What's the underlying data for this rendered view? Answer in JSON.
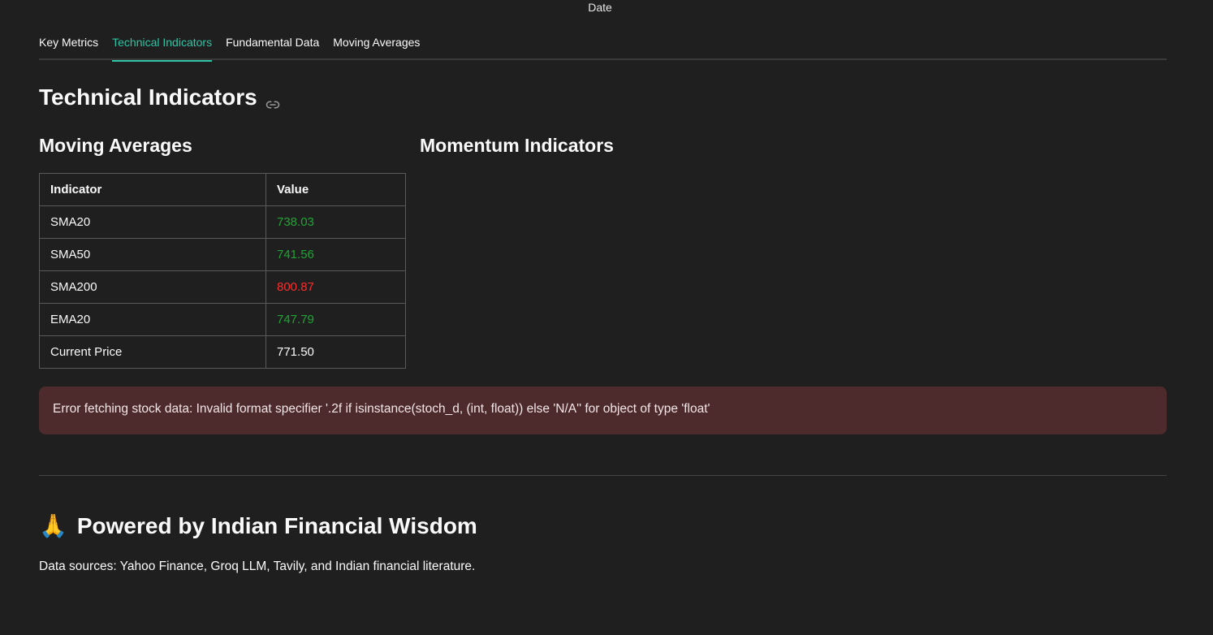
{
  "chart_axis": {
    "xlabel": "Date"
  },
  "tabs": [
    {
      "label": "Key Metrics",
      "active": false
    },
    {
      "label": "Technical Indicators",
      "active": true
    },
    {
      "label": "Fundamental Data",
      "active": false
    },
    {
      "label": "Moving Averages",
      "active": false
    }
  ],
  "main": {
    "title": "Technical Indicators",
    "title_icon": "link-icon",
    "moving_averages": {
      "title": "Moving Averages",
      "headers": [
        "Indicator",
        "Value"
      ],
      "rows": [
        {
          "indicator": "SMA20",
          "value": "738.03",
          "color": "#21a336"
        },
        {
          "indicator": "SMA50",
          "value": "741.56",
          "color": "#21a336"
        },
        {
          "indicator": "SMA200",
          "value": "800.87",
          "color": "#ff2b2b"
        },
        {
          "indicator": "EMA20",
          "value": "747.79",
          "color": "#21a336"
        },
        {
          "indicator": "Current Price",
          "value": "771.50",
          "color": "#fafafa"
        }
      ]
    },
    "momentum": {
      "title": "Momentum Indicators"
    },
    "error": "Error fetching stock data: Invalid format specifier '.2f if isinstance(stoch_d, (int, float)) else 'N/A'' for object of type 'float'"
  },
  "footer": {
    "icon": "folded-hands-icon",
    "title": "Powered by Indian Financial Wisdom",
    "sources": "Data sources: Yahoo Finance, Groq LLM, Tavily, and Indian financial literature."
  },
  "colors": {
    "accent": "#2ec4a5",
    "positive": "#21a336",
    "negative": "#ff2b2b",
    "error_bg": "#4d2b2d"
  }
}
